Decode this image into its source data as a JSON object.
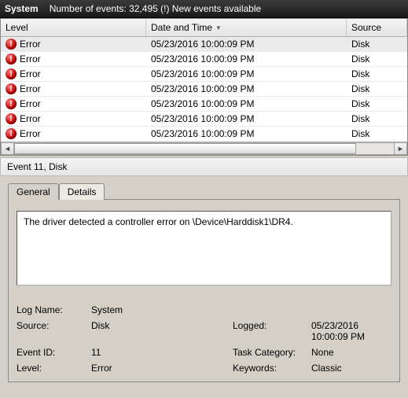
{
  "topbar": {
    "title": "System",
    "status": "Number of events: 32,495 (!) New events available"
  },
  "columns": {
    "level": "Level",
    "date": "Date and Time",
    "source": "Source"
  },
  "rows": [
    {
      "level": "Error",
      "date": "05/23/2016 10:00:09 PM",
      "source": "Disk"
    },
    {
      "level": "Error",
      "date": "05/23/2016 10:00:09 PM",
      "source": "Disk"
    },
    {
      "level": "Error",
      "date": "05/23/2016 10:00:09 PM",
      "source": "Disk"
    },
    {
      "level": "Error",
      "date": "05/23/2016 10:00:09 PM",
      "source": "Disk"
    },
    {
      "level": "Error",
      "date": "05/23/2016 10:00:09 PM",
      "source": "Disk"
    },
    {
      "level": "Error",
      "date": "05/23/2016 10:00:09 PM",
      "source": "Disk"
    },
    {
      "level": "Error",
      "date": "05/23/2016 10:00:09 PM",
      "source": "Disk"
    }
  ],
  "event_header": "Event 11, Disk",
  "tabs": {
    "general": "General",
    "details": "Details"
  },
  "description": "The driver detected a controller error on \\Device\\Harddisk1\\DR4.",
  "props": {
    "log_name_lbl": "Log Name:",
    "log_name_val": "System",
    "source_lbl": "Source:",
    "source_val": "Disk",
    "logged_lbl": "Logged:",
    "logged_val": "05/23/2016 10:00:09 PM",
    "event_id_lbl": "Event ID:",
    "event_id_val": "11",
    "task_cat_lbl": "Task Category:",
    "task_cat_val": "None",
    "level_lbl": "Level:",
    "level_val": "Error",
    "keywords_lbl": "Keywords:",
    "keywords_val": "Classic"
  }
}
